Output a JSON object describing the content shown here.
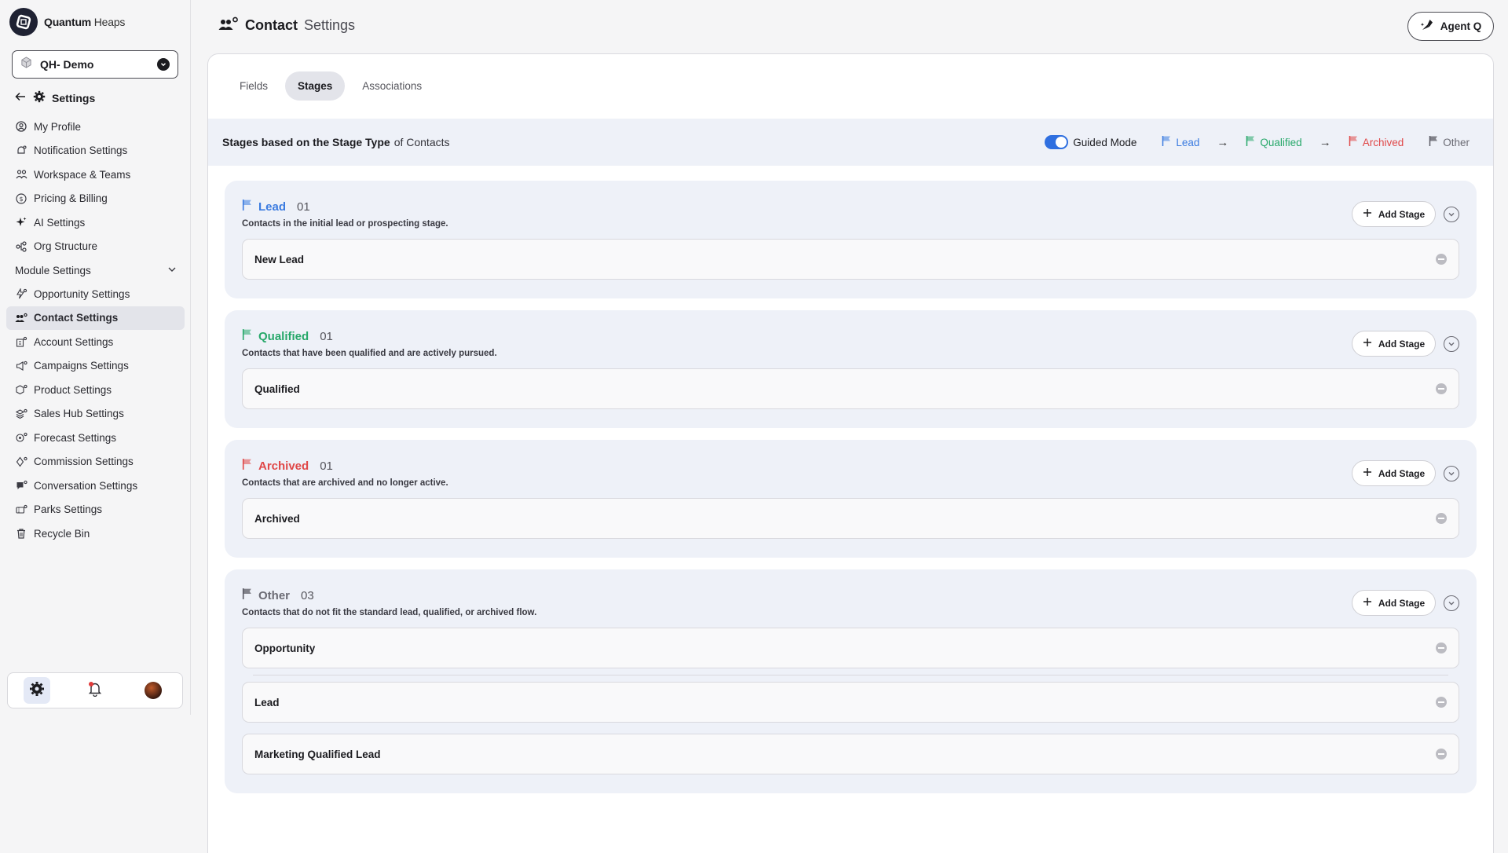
{
  "brand": {
    "name_bold": "Quantum",
    "name_light": "Heaps"
  },
  "workspace": {
    "label": "QH- Demo"
  },
  "settings": {
    "label": "Settings"
  },
  "nav": {
    "items_top": [
      {
        "label": "My Profile",
        "icon": "user-circle-icon"
      },
      {
        "label": "Notification Settings",
        "icon": "bell-icon"
      },
      {
        "label": "Workspace & Teams",
        "icon": "team-icon"
      },
      {
        "label": "Pricing & Billing",
        "icon": "dollar-icon"
      },
      {
        "label": "AI Settings",
        "icon": "sparkle-icon"
      },
      {
        "label": "Org Structure",
        "icon": "hierarchy-icon"
      }
    ],
    "group_label": "Module Settings",
    "items_module": [
      {
        "label": "Opportunity Settings"
      },
      {
        "label": "Contact Settings"
      },
      {
        "label": "Account Settings"
      },
      {
        "label": "Campaigns Settings"
      },
      {
        "label": "Product Settings"
      },
      {
        "label": "Sales Hub Settings"
      },
      {
        "label": "Forecast Settings"
      },
      {
        "label": "Commission Settings"
      },
      {
        "label": "Conversation Settings"
      },
      {
        "label": "Parks Settings"
      },
      {
        "label": "Recycle Bin"
      }
    ]
  },
  "header": {
    "title": "Contact",
    "subtitle": "Settings",
    "agent_label": "Agent Q"
  },
  "tabs": [
    "Fields",
    "Stages",
    "Associations"
  ],
  "stage_bar": {
    "title_bold": "Stages based on the Stage Type",
    "title_rest": "of Contacts",
    "guided_mode": "Guided Mode",
    "legend": [
      {
        "label": "Lead",
        "color": "#3b7be0"
      },
      {
        "label": "Qualified",
        "color": "#27a86a"
      },
      {
        "label": "Archived",
        "color": "#e04848"
      },
      {
        "label": "Other",
        "color": "#6b6b74"
      }
    ],
    "arrow": "→"
  },
  "colors": {
    "lead": "#3b7be0",
    "qualified": "#27a86a",
    "archived": "#e04848",
    "other": "#5c5c66"
  },
  "add_stage_label": "Add Stage",
  "groups": [
    {
      "name": "Lead",
      "count": "01",
      "desc": "Contacts in the initial lead or prospecting stage.",
      "stages": [
        "New Lead"
      ]
    },
    {
      "name": "Qualified",
      "count": "01",
      "desc": "Contacts that have been qualified and are actively pursued.",
      "stages": [
        "Qualified"
      ]
    },
    {
      "name": "Archived",
      "count": "01",
      "desc": "Contacts that are archived and no longer active.",
      "stages": [
        "Archived"
      ]
    },
    {
      "name": "Other",
      "count": "03",
      "desc": "Contacts that do not fit the standard lead, qualified, or archived flow.",
      "stages": [
        "Opportunity",
        "Lead",
        "Marketing Qualified Lead"
      ]
    }
  ]
}
